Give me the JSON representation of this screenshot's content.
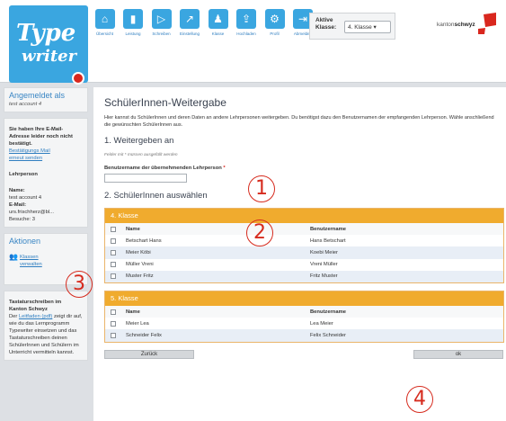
{
  "logo": {
    "line1": "Type",
    "line2": "writer"
  },
  "nav": [
    {
      "icon": "home-icon",
      "glyph": "⌂",
      "label": "Übersicht"
    },
    {
      "icon": "bar-chart-icon",
      "glyph": "▮",
      "label": "Leistung"
    },
    {
      "icon": "play-icon",
      "glyph": "▷",
      "label": "Schreiben"
    },
    {
      "icon": "chart-line-icon",
      "glyph": "↗",
      "label": "Einstellung"
    },
    {
      "icon": "group-icon",
      "glyph": "♟",
      "label": "Klasse"
    },
    {
      "icon": "upload-icon",
      "glyph": "⇪",
      "label": "Hochladen"
    },
    {
      "icon": "gear-icon",
      "glyph": "⚙",
      "label": "Profil"
    },
    {
      "icon": "logout-icon",
      "glyph": "⇥",
      "label": "Abmelden"
    }
  ],
  "klasse_select": {
    "label_line1": "Aktive",
    "label_line2": "Klasse:",
    "value": "4. Klasse ▾"
  },
  "brand": {
    "prefix": "kanton",
    "name": "schwyz"
  },
  "sidebar": {
    "login": {
      "heading": "Angemeldet als",
      "user": "test account 4"
    },
    "info": {
      "warning": "Sie haben Ihre E-Mail-Adresse leider noch nicht bestätigt.",
      "link1": "Bestätigungs Mail",
      "link2": "erneut senden",
      "role": "Lehrperson",
      "name_label": "Name:",
      "name_value": "test account 4",
      "email_label": "E-Mail:",
      "email_value": "urs.frischherz@bl...",
      "visits": "Besuche: 3"
    },
    "actions": {
      "heading": "Aktionen",
      "link1": "Klassen",
      "link2": "verwalten"
    },
    "help": {
      "title1": "Tastaturschreiben im",
      "title2": "Kanton Schwyz",
      "text_pre": "Der ",
      "text_link": "Leitfaden (pdf)",
      "text_post": " zeigt dir auf, wie du das Lernprogramm Typewriter einsetzen und das Tastaturschreiben deinen SchülerInnen und Schülern im Unterricht vermitteln kannst."
    }
  },
  "main": {
    "title": "SchülerInnen-Weitergabe",
    "intro": "Hier kannst du SchülerInnen und deren Daten an andere Lehrpersonen weitergeben. Du benötigst dazu den Benutzernamen der empfangenden Lehrperson. Wähle anschließend die gewünschten SchülerInnen aus.",
    "section1": "1. Weitergeben an",
    "required_note": "Felder mit * müssen ausgefüllt werden",
    "field_label": "Benutzername der übernehmenden Lehrperson ",
    "field_star": "*",
    "section2": "2. SchülerInnen auswählen",
    "classes": [
      {
        "name": "4. Klasse",
        "col_name": "Name",
        "col_user": "Benutzername",
        "rows": [
          {
            "name": "Betschart Hans",
            "user": "Hans Betschart"
          },
          {
            "name": "Meier Köbi",
            "user": "Koebi Meier"
          },
          {
            "name": "Müller Vreni",
            "user": "Vreni Müller"
          },
          {
            "name": "Muster Fritz",
            "user": "Fritz Muster"
          }
        ]
      },
      {
        "name": "5. Klasse",
        "col_name": "Name",
        "col_user": "Benutzername",
        "rows": [
          {
            "name": "Meier Lea",
            "user": "Lea Meier"
          },
          {
            "name": "Schneider Felix",
            "user": "Felix Schneider"
          }
        ]
      }
    ],
    "back_label": "Zurück",
    "ok_label": "ok"
  },
  "annotations": [
    "1",
    "2",
    "3",
    "4"
  ],
  "colors": {
    "accent_blue": "#3aa6e0",
    "class_header": "#f0ab2e",
    "annotation_red": "#d62b1e",
    "brand_red": "#d9271e"
  }
}
